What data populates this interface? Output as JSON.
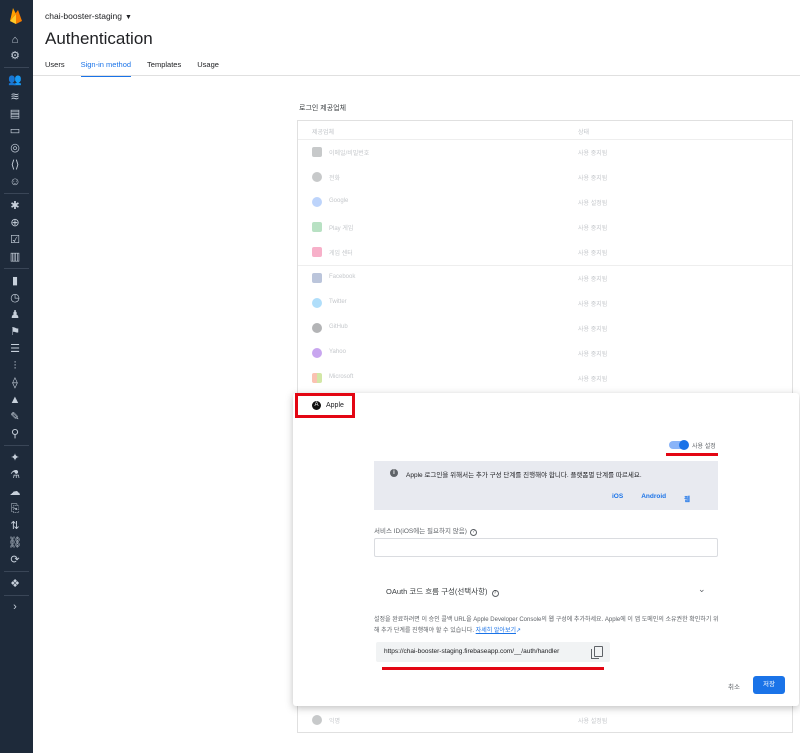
{
  "header": {
    "project": "chai-booster-staging",
    "title": "Authentication",
    "tabs": [
      {
        "label": "Users",
        "active": false
      },
      {
        "label": "Sign-in method",
        "active": true
      },
      {
        "label": "Templates",
        "active": false
      },
      {
        "label": "Usage",
        "active": false
      }
    ]
  },
  "providers": {
    "heading": "로그인 제공업체",
    "col_provider": "제공업체",
    "col_status": "상태",
    "rows": [
      {
        "name": "이메일/비밀번호",
        "status": "사용 중지됨",
        "icon": "mail-icon"
      },
      {
        "name": "전화",
        "status": "사용 중지됨",
        "icon": "phone-icon"
      },
      {
        "name": "Google",
        "status": "사용 설정됨",
        "icon": "google-icon"
      },
      {
        "name": "Play 게임",
        "status": "사용 중지됨",
        "icon": "play-games-icon"
      },
      {
        "name": "게임 센터",
        "status": "사용 중지됨",
        "icon": "game-center-icon"
      },
      {
        "name": "Facebook",
        "status": "사용 중지됨",
        "icon": "facebook-icon"
      },
      {
        "name": "Twitter",
        "status": "사용 중지됨",
        "icon": "twitter-icon"
      },
      {
        "name": "GitHub",
        "status": "사용 중지됨",
        "icon": "github-icon"
      },
      {
        "name": "Yahoo",
        "status": "사용 중지됨",
        "icon": "yahoo-icon"
      },
      {
        "name": "Microsoft",
        "status": "사용 중지됨",
        "icon": "microsoft-icon"
      }
    ],
    "last_row": {
      "name": "익명",
      "status": "사용 설정됨",
      "icon": "anonymous-icon"
    }
  },
  "apple_panel": {
    "provider_name": "Apple",
    "enable_label": "사용 설정",
    "enabled": true,
    "info_text": "Apple 로그인을 위해서는 추가 구성 단계를 진행해야 합니다. 플랫폼별 단계를 따르세요.",
    "platform_links": [
      "iOS",
      "Android",
      "웹"
    ],
    "service_id_label": "서비스 ID(iOS에는 필요하지 않음)",
    "service_id_value": "",
    "oauth_section_label": "OAuth 코드 흐름 구성(선택사항)",
    "description": "설정을 완료하려면 이 승인 콜백 URL을 Apple Developer Console의 웹 구성에 추가하세요. Apple에 이 앱 도메인의 소유권한 확인하기 위해 추가 단계를 진행해야 할 수 있습니다.",
    "learn_more": "자세히 알아보기",
    "callback_url": "https://chai-booster-staging.firebaseapp.com/__/auth/handler",
    "cancel_label": "취소",
    "save_label": "저장"
  },
  "colors": {
    "sidebar": "#1e2a3a",
    "accent": "#1a73e8",
    "highlight": "#e30613"
  }
}
